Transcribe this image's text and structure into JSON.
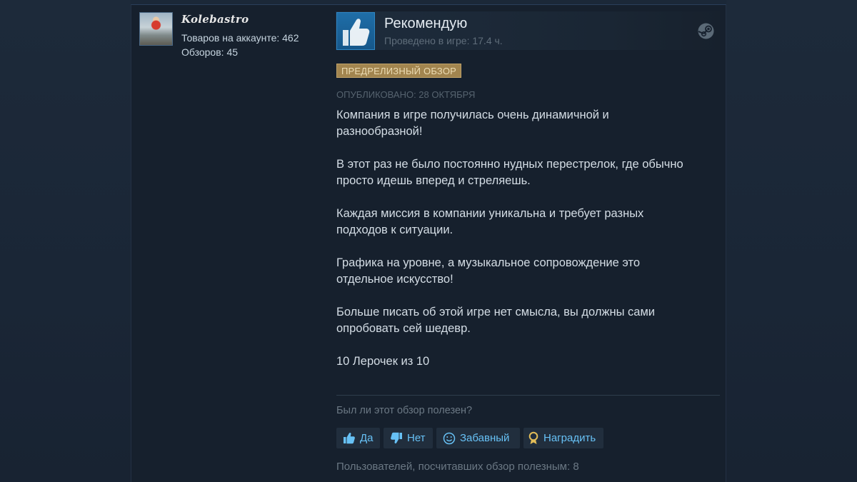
{
  "reviewer": {
    "name": "Kolebastro",
    "products_label": "Товаров на аккаунте: 462",
    "reviews_label": "Обзоров: 45"
  },
  "review": {
    "recommendation": "Рекомендую",
    "playtime": "Проведено в игре: 17.4 ч.",
    "badge": "ПРЕДРЕЛИЗНЫЙ ОБЗОР",
    "posted": "ОПУБЛИКОВАНО: 28 ОКТЯБРЯ",
    "paragraphs": [
      [
        "Компания в игре получилась очень динамичной и",
        "разнообразной!"
      ],
      [
        "В этот раз не было постоянно нудных перестрелок, где обычно",
        "просто идешь вперед и стреляешь."
      ],
      [
        "Каждая миссия в компании уникальна и требует разных",
        "подходов к ситуации."
      ],
      [
        "Графика на уровне, а музыкальное сопровождение это",
        "отдельное искусство!"
      ],
      [
        "Больше писать об этой игре нет смысла, вы должны сами",
        "опробовать сей шедевр."
      ],
      [
        "10 Лерочек из 10"
      ]
    ]
  },
  "feedback": {
    "question": "Был ли этот обзор полезен?",
    "yes": "Да",
    "no": "Нет",
    "funny": "Забавный",
    "award": "Наградить",
    "helpful_count": "Пользователей, посчитавших обзор полезным: 8"
  },
  "colors": {
    "accent": "#67c1f5",
    "badge": "#a2854f",
    "thumb": "#1f6ea8"
  },
  "icons": {
    "thumbs_up": "thumbs-up-icon",
    "steam": "steam-logo-icon",
    "thumbs_down": "thumbs-down-icon",
    "smile": "smile-icon",
    "award": "award-ribbon-icon"
  }
}
